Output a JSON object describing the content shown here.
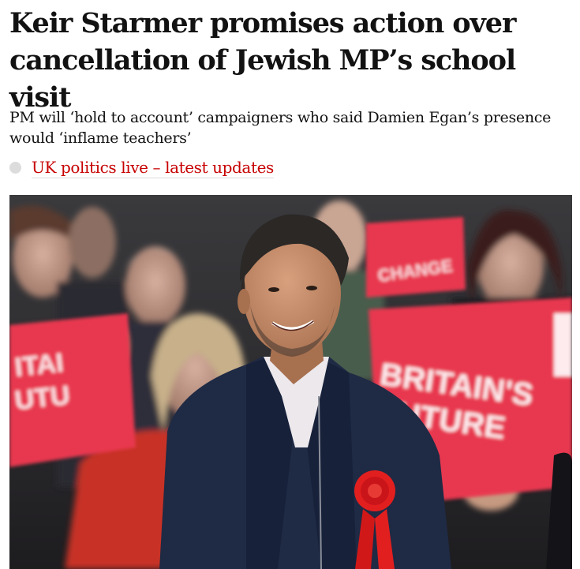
{
  "article": {
    "headline": "Keir Starmer promises action over cancellation of Jewish MP’s school visit",
    "standfirst": "PM will ‘hold to account’ campaigners who said Damien Egan’s presence would ‘inflame teachers’",
    "live_link_label": "UK politics live – latest updates",
    "photo": {
      "sign_left_text": "BRITAIN’S FUTURE",
      "sign_right_text": "BRITAIN’S FUTURE",
      "sign_top_text": "CHANGE"
    }
  },
  "colors": {
    "headline": "#121212",
    "link": "#c70000",
    "sign_red": "#e8384f",
    "rosette_red": "#e21f1f"
  }
}
